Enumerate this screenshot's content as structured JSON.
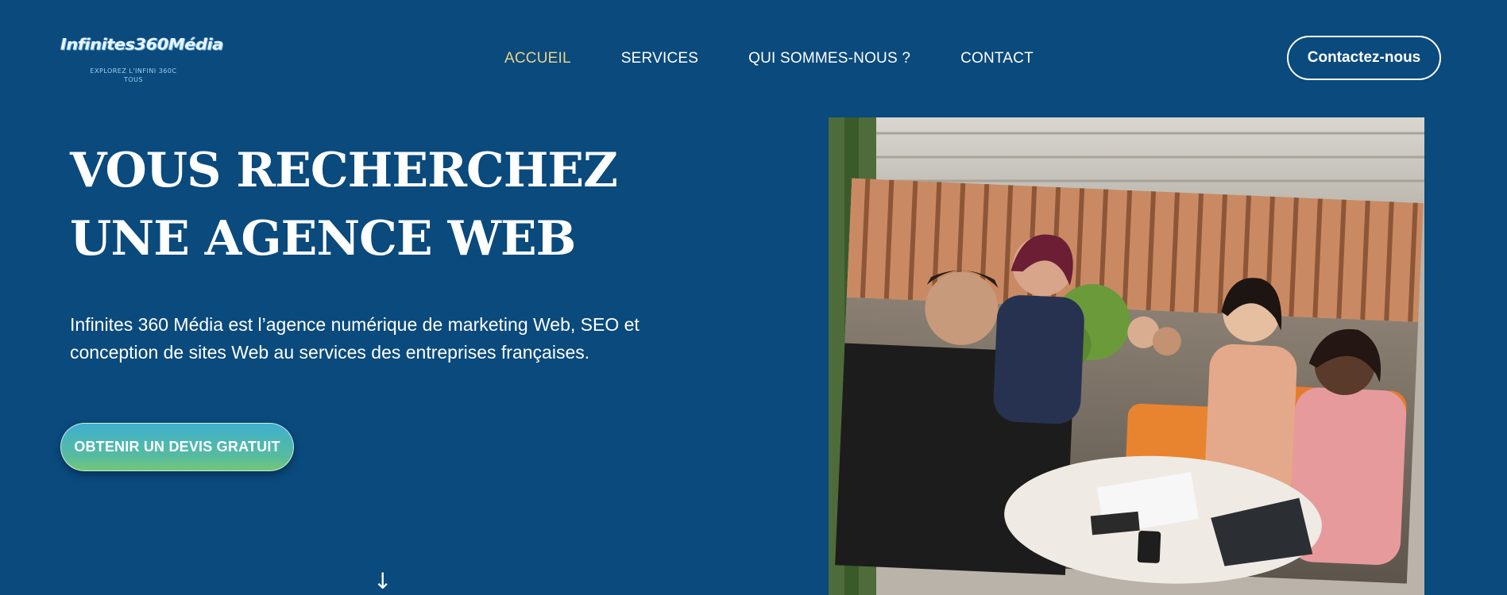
{
  "logo": {
    "name": "InfinitesзбоMédia",
    "tagline": "EXPLOREZ L'INFINI  360C TOUS"
  },
  "nav": {
    "items": [
      {
        "label": "ACCUEIL",
        "active": true
      },
      {
        "label": "SERVICES",
        "active": false
      },
      {
        "label": "QUI SOMMES-NOUS ?",
        "active": false
      },
      {
        "label": "CONTACT",
        "active": false
      }
    ]
  },
  "header": {
    "contact_label": "Contactez-nous"
  },
  "hero": {
    "title": "VOUS RECHERCHEZ UNE AGENCE WEB",
    "description": "Infinites 360 Média est l’agence numérique de marketing Web, SEO et conception de sites Web au services des entreprises françaises.",
    "cta_label": "OBTENIR UN DEVIS GRATUIT",
    "scroll_icon": "arrow-down-icon"
  },
  "photo": {
    "subject": "team-high-five-photo"
  },
  "colors": {
    "background": "#0a4a7d",
    "nav_active": "#e7d38a",
    "cta_top": "#3fb0cf",
    "cta_bottom": "#74c774"
  }
}
